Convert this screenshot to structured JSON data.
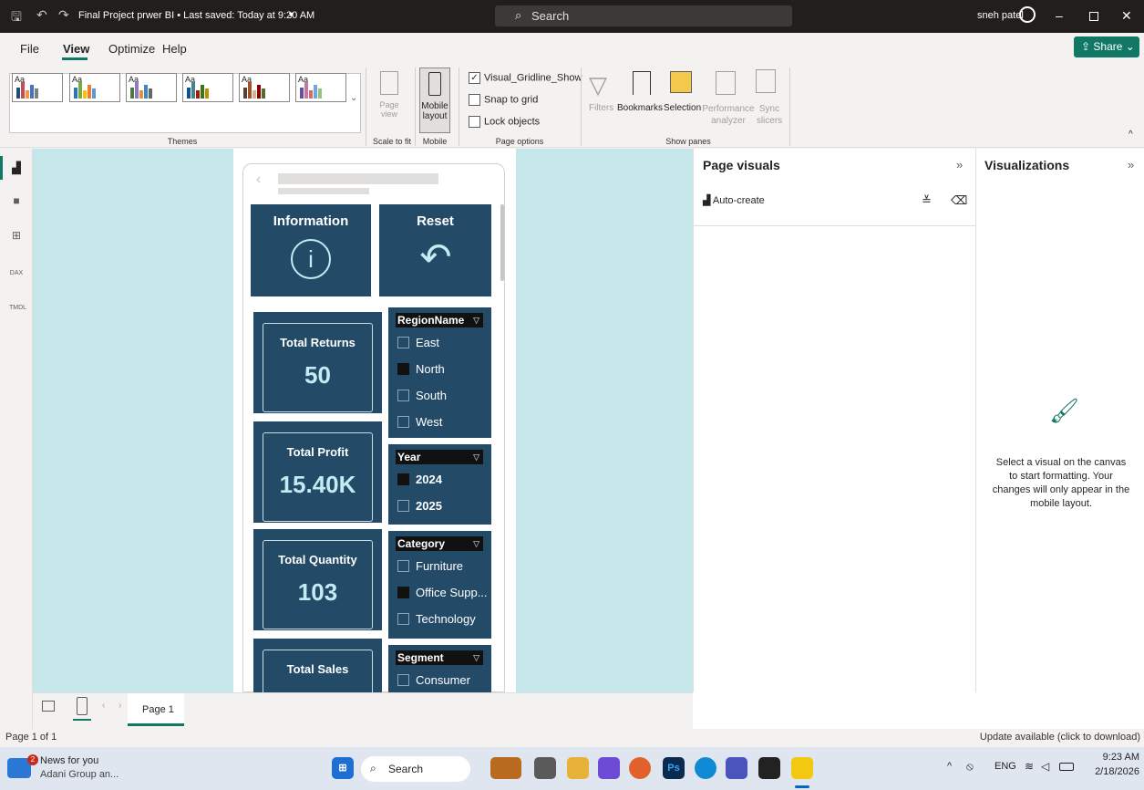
{
  "titlebar": {
    "title": "Final Project prwer BI • Last saved: Today at 9:20 AM",
    "search": "Search",
    "user": "sneh patel"
  },
  "menu": {
    "file": "File",
    "view": "View",
    "optimize": "Optimize",
    "help": "Help",
    "share": "Share"
  },
  "ribbon": {
    "themes_label": "Themes",
    "theme_aa": "Aa",
    "page_view": "Page view",
    "scale_to_fit": "Scale to fit",
    "mobile_layout": "Mobile layout",
    "mobile": "Mobile",
    "gridlines": "Visual_Gridline_Show",
    "snap": "Snap to grid",
    "lock": "Lock objects",
    "page_options": "Page options",
    "filters": "Filters",
    "bookmarks": "Bookmarks",
    "selection": "Selection",
    "performance": "Performance analyzer",
    "sync": "Sync slicers",
    "show_panes": "Show panes"
  },
  "rail": {
    "dax": "DAX",
    "tmdl": "TMDL"
  },
  "report": {
    "information": "Information",
    "reset": "Reset",
    "kpis": [
      {
        "name": "Total Returns",
        "value": "50"
      },
      {
        "name": "Total Profit",
        "value": "15.40K"
      },
      {
        "name": "Total Quantity",
        "value": "103"
      },
      {
        "name": "Total Sales",
        "value": ""
      }
    ],
    "region": {
      "title": "RegionName",
      "options": [
        "East",
        "North",
        "South",
        "West"
      ],
      "checked": [
        false,
        true,
        false,
        false
      ]
    },
    "year": {
      "title": "Year",
      "options": [
        "2024",
        "2025"
      ],
      "checked": [
        true,
        false
      ]
    },
    "category": {
      "title": "Category",
      "options": [
        "Furniture",
        "Office Supp...",
        "Technology"
      ],
      "checked": [
        false,
        true,
        false
      ]
    },
    "segment": {
      "title": "Segment",
      "options": [
        "Consumer"
      ],
      "checked": [
        false
      ]
    }
  },
  "pagevisuals": {
    "title": "Page visuals",
    "autocreate": "Auto-create"
  },
  "visualizations": {
    "title": "Visualizations",
    "hint": "Select a visual on the canvas to start formatting. Your changes will only appear in the mobile layout."
  },
  "pagetabs": {
    "tab": "Page 1"
  },
  "status": {
    "page": "Page 1 of 1",
    "update": "Update available (click to download)"
  },
  "taskbar": {
    "news_title": "News for you",
    "news_sub": "Adani Group an...",
    "news_badge": "2",
    "search": "Search",
    "lang": "ENG",
    "time": "9:23 AM",
    "date": "2/18/2026"
  },
  "colors": {
    "tile": "#234a67",
    "canvas": "#c5e7ea",
    "kpi_value": "#c2ebf3",
    "accent": "#117865"
  }
}
